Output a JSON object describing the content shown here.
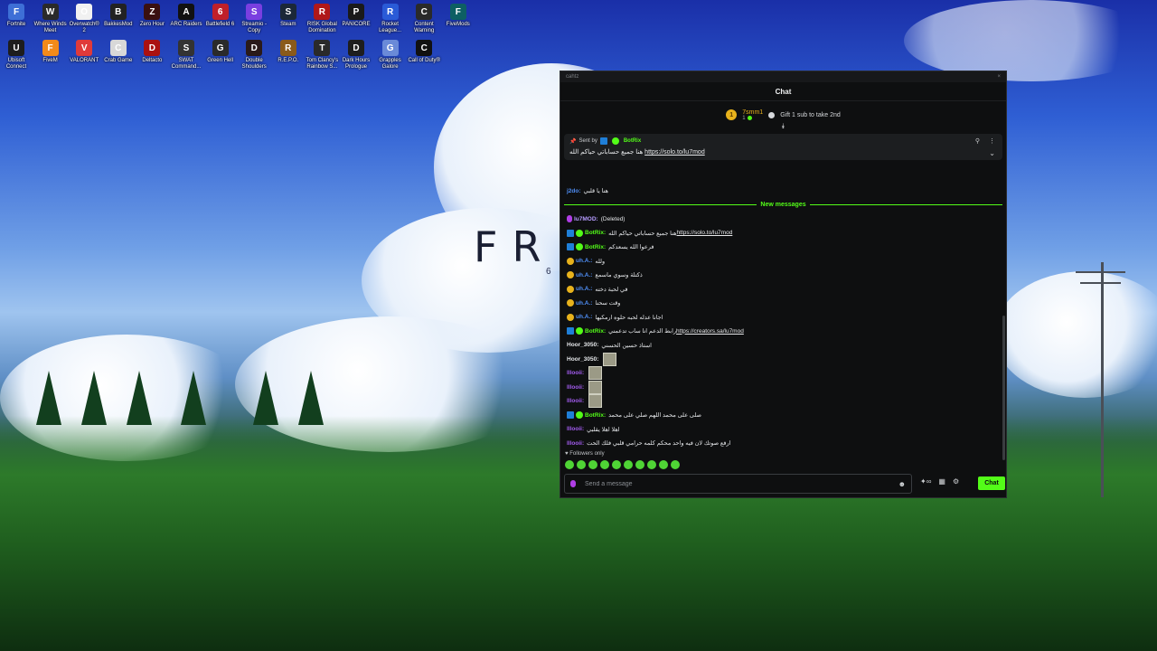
{
  "desktop": {
    "row1": [
      {
        "label": "Fortnite",
        "color": "#3e6fd6",
        "glyph": "F"
      },
      {
        "label": "Where Winds Meet",
        "color": "#2a2a2a",
        "glyph": "W"
      },
      {
        "label": "Overwatch® 2",
        "color": "#f1f1f1",
        "glyph": "O"
      },
      {
        "label": "BakkesMod",
        "color": "#222",
        "glyph": "B"
      },
      {
        "label": "Zero Hour",
        "color": "#3a1010",
        "glyph": "Z"
      },
      {
        "label": "ARC Raiders",
        "color": "#111",
        "glyph": "A"
      },
      {
        "label": "Battlefield 6",
        "color": "#c0202a",
        "glyph": "6"
      },
      {
        "label": "Streamio - Copy",
        "color": "#7a3fe0",
        "glyph": "S"
      },
      {
        "label": "Steam",
        "color": "#1b2838",
        "glyph": "S"
      },
      {
        "label": "RISK Global Domination",
        "color": "#b01818",
        "glyph": "R"
      },
      {
        "label": "PANICORE",
        "color": "#1a1a1a",
        "glyph": "P"
      },
      {
        "label": "Rocket League...",
        "color": "#2a5bd7",
        "glyph": "R"
      },
      {
        "label": "Content Warning",
        "color": "#2a2a2a",
        "glyph": "C"
      },
      {
        "label": "FiveMods",
        "color": "#0d5f63",
        "glyph": "F"
      }
    ],
    "row2": [
      {
        "label": "Ubisoft Connect",
        "color": "#1d1d1d",
        "glyph": "U"
      },
      {
        "label": "FiveM",
        "color": "#f28a1a",
        "glyph": "F"
      },
      {
        "label": "VALORANT",
        "color": "#e03a3a",
        "glyph": "V"
      },
      {
        "label": "Crab Game",
        "color": "#d8d8d8",
        "glyph": "C"
      },
      {
        "label": "Deltacto",
        "color": "#a11",
        "glyph": "D"
      },
      {
        "label": "SWAT Command...",
        "color": "#333",
        "glyph": "S"
      },
      {
        "label": "Green Hell",
        "color": "#2a2a2a",
        "glyph": "G"
      },
      {
        "label": "Double Shoulders",
        "color": "#2a1a1a",
        "glyph": "D"
      },
      {
        "label": "R.E.P.O.",
        "color": "#8a5a1a",
        "glyph": "R"
      },
      {
        "label": "Tom Clancy's Rainbow S...",
        "color": "#2a2a2a",
        "glyph": "T"
      },
      {
        "label": "Dark Hours Prologue",
        "color": "#1e1e1e",
        "glyph": "D"
      },
      {
        "label": "Grapples Galore",
        "color": "#6a8ad8",
        "glyph": "G"
      },
      {
        "label": "Call of Duty®",
        "color": "#111",
        "glyph": "C"
      }
    ],
    "bg_text": "FR",
    "bg_subtext": "6 F"
  },
  "window": {
    "titlebar_text": "cahtz",
    "close_glyph": "×",
    "header_title": "Chat"
  },
  "gifter": {
    "rank": "1",
    "name": "7smm1",
    "count": "1",
    "gift_text": "Gift 1 sub to take 2nd"
  },
  "pinned": {
    "sent_by_label": "Sent by",
    "sender": "BotRix",
    "message_text": "هنا جميع حساباتي حياكم الله",
    "message_link": "https://solo.to/lu7mod"
  },
  "messages": [
    {
      "user": "j2do",
      "user_color": "#4f8ff7",
      "text": "هنا يا قلبي",
      "badges": []
    },
    {
      "divider": "New messages"
    },
    {
      "user": "lu7MOD",
      "user_color": "#b69cff",
      "text": "(Deleted)",
      "badges": [
        "mic"
      ]
    },
    {
      "user": "BotRix",
      "user_color": "#53fc18",
      "text": "هنا جميع حساباتي حياكم الله",
      "link": "https://solo.to/lu7mod",
      "badges": [
        "bot",
        "ver"
      ]
    },
    {
      "user": "BotRix",
      "user_color": "#53fc18",
      "text": "فرعوا الله يسعدكم",
      "badges": [
        "bot",
        "ver"
      ]
    },
    {
      "user": "uh.A.",
      "user_color": "#4f8ff7",
      "text": "ولله",
      "badges": [
        "gold"
      ]
    },
    {
      "user": "uh.A.",
      "user_color": "#4f8ff7",
      "text": "ذكتلة وسوي ماسمع",
      "badges": [
        "gold"
      ]
    },
    {
      "user": "uh.A.",
      "user_color": "#4f8ff7",
      "text": "في لحبة دخته",
      "badges": [
        "gold"
      ]
    },
    {
      "user": "uh.A.",
      "user_color": "#4f8ff7",
      "text": "وقت سحنا",
      "badges": [
        "gold"
      ]
    },
    {
      "user": "uh.A.",
      "user_color": "#4f8ff7",
      "text": "اجانا عدله لحبه حلوه ارمكيها",
      "badges": [
        "gold"
      ]
    },
    {
      "user": "BotRix",
      "user_color": "#53fc18",
      "text": "رابط الدعم انا ساب تدعمني",
      "link": "https://creators.sa/lu7mod",
      "badges": [
        "bot",
        "ver"
      ]
    },
    {
      "user": "Hoor_3050",
      "user_color": "#e4e6e9",
      "text": "استاذ حسين الحسني",
      "badges": []
    },
    {
      "user": "Hoor_3050",
      "user_color": "#e4e6e9",
      "text": "",
      "emote": true,
      "badges": []
    },
    {
      "user": "lllooii",
      "user_color": "#a35cf0",
      "text": "",
      "emote": true,
      "badges": []
    },
    {
      "user": "lllooii",
      "user_color": "#a35cf0",
      "text": "",
      "emote": true,
      "badges": []
    },
    {
      "user": "lllooii",
      "user_color": "#a35cf0",
      "text": "",
      "emote": true,
      "badges": []
    },
    {
      "user": "BotRix",
      "user_color": "#53fc18",
      "text": "صلى على محمد اللهم صلي على محمد",
      "badges": [
        "bot",
        "ver"
      ]
    },
    {
      "user": "lllooii",
      "user_color": "#a35cf0",
      "text": "اهلا اهلا يقلبي",
      "badges": []
    },
    {
      "user": "lllooii",
      "user_color": "#a35cf0",
      "text": "ارفع صوتك لان فيه واحد محكم كلمه حرامي قلبي فلك الحت",
      "badges": []
    }
  ],
  "followers_label": "Followers only",
  "input": {
    "placeholder": "Send a message",
    "emoji_glyph": "☻"
  },
  "tools": {
    "points_label": "∞"
  },
  "chat_button": "Chat",
  "colors": {
    "accent": "#53fc18",
    "bg": "#0e0f10"
  }
}
